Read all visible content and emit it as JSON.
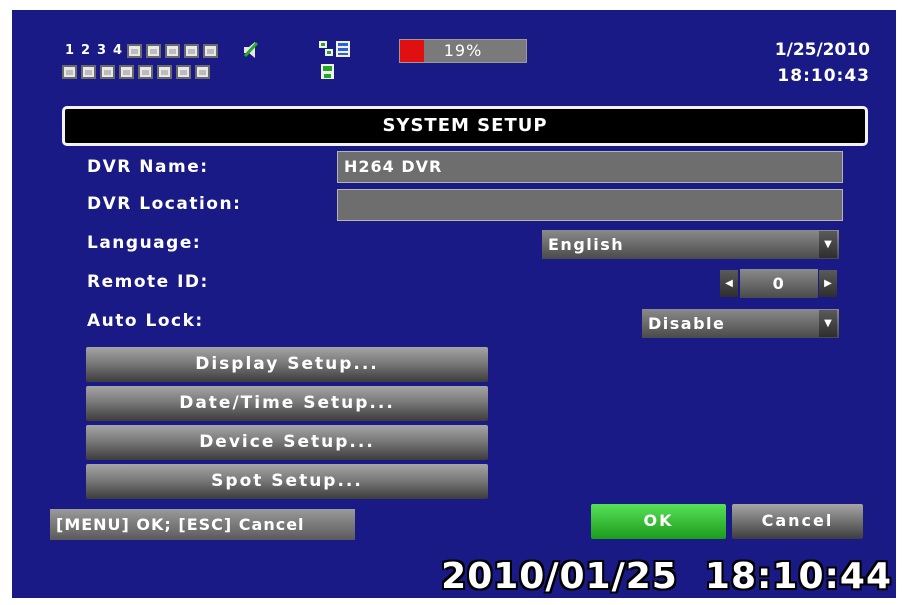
{
  "status_bar": {
    "channels_top": [
      "1",
      "2",
      "3",
      "4"
    ],
    "hdd_percent": "19%",
    "hdd_percent_value": 0.19,
    "date": "1/25/2010",
    "time": "18:10:43"
  },
  "dialog": {
    "title": "SYSTEM SETUP",
    "fields": {
      "dvr_name_label": "DVR Name:",
      "dvr_name_value": "H264 DVR",
      "dvr_location_label": "DVR Location:",
      "dvr_location_value": "",
      "language_label": "Language:",
      "language_value": "English",
      "remote_id_label": "Remote ID:",
      "remote_id_value": "0",
      "auto_lock_label": "Auto Lock:",
      "auto_lock_value": "Disable"
    },
    "buttons": {
      "display_setup": "Display Setup...",
      "datetime_setup": "Date/Time Setup...",
      "device_setup": "Device Setup...",
      "spot_setup": "Spot Setup...",
      "ok": "OK",
      "cancel": "Cancel"
    },
    "hint": "[MENU] OK; [ESC] Cancel"
  },
  "footer": {
    "osd_datetime": "2010/01/25  18:10:44"
  },
  "colors": {
    "background": "#1a1a86",
    "hdd_used": "#e01010",
    "ok_button": "#22b822"
  },
  "icons": [
    "speaker-mute-icon",
    "network-icon",
    "record-icon",
    "disk-icon",
    "dropdown-arrow-icon",
    "arrow-left-icon",
    "arrow-right-icon"
  ]
}
